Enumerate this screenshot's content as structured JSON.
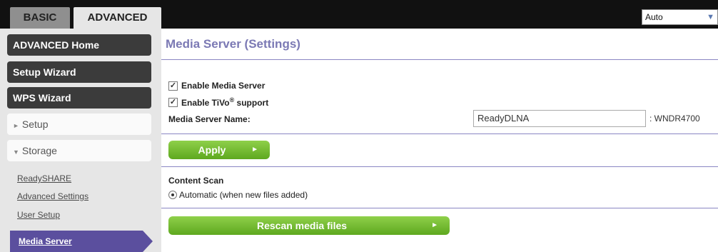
{
  "tabs": {
    "basic": "BASIC",
    "advanced": "ADVANCED"
  },
  "language": {
    "selected": "Auto"
  },
  "sidebar": {
    "advanced_home": "ADVANCED Home",
    "setup_wizard": "Setup Wizard",
    "wps_wizard": "WPS Wizard",
    "setup": "Setup",
    "storage": "Storage",
    "storage_items": [
      "ReadySHARE",
      "Advanced Settings",
      "User Setup",
      "Media Server"
    ]
  },
  "main": {
    "title": "Media Server (Settings)",
    "enable_media_server": "Enable Media Server",
    "enable_tivo": "Enable TiVo",
    "tivo_sup": "®",
    "tivo_suffix": " support",
    "server_name_label": "Media Server Name:",
    "server_name_value": "ReadyDLNA",
    "server_name_suffix": ": WNDR4700",
    "apply_label": "Apply",
    "content_scan_label": "Content Scan",
    "automatic_option": "Automatic (when new files added)",
    "rescan_label": "Rescan media files"
  },
  "colors": {
    "accent": "#7b79b4",
    "active_nav": "#5b4f9e",
    "button_green": "#6cb22a"
  }
}
